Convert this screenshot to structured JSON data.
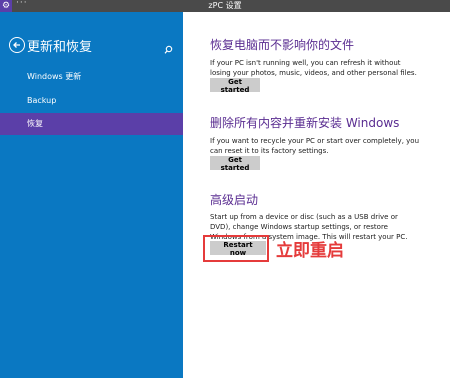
{
  "window": {
    "title": "zPC 设置",
    "menu_glyph": "···"
  },
  "sidebar": {
    "title": "更新和恢复",
    "items": [
      {
        "label": "Windows 更新"
      },
      {
        "label": "Backup"
      },
      {
        "label": "恢复"
      }
    ],
    "selected_index": 2
  },
  "sections": [
    {
      "title": "恢复电脑而不影响你的文件",
      "description": "If your PC isn't running well, you can refresh it without losing your photos, music, videos, and other personal files.",
      "button": "Get started"
    },
    {
      "title": "删除所有内容并重新安装 Windows",
      "description": "If you want to recycle your PC or start over completely, you can reset it to its factory settings.",
      "button": "Get started"
    },
    {
      "title": "高级启动",
      "description": "Start up from a device or disc (such as a USB drive or DVD), change Windows startup settings, or restore Windows from a system image. This will restart your PC.",
      "button": "Restart now"
    }
  ],
  "annotation": {
    "text": "立即重启",
    "color": "#e53b3b"
  },
  "colors": {
    "sidebar": "#0a78c2",
    "selected": "#5b3fa8",
    "section_title": "#5a2d91"
  },
  "icons": [
    "settings-app-icon",
    "back-arrow-icon",
    "search-icon"
  ]
}
